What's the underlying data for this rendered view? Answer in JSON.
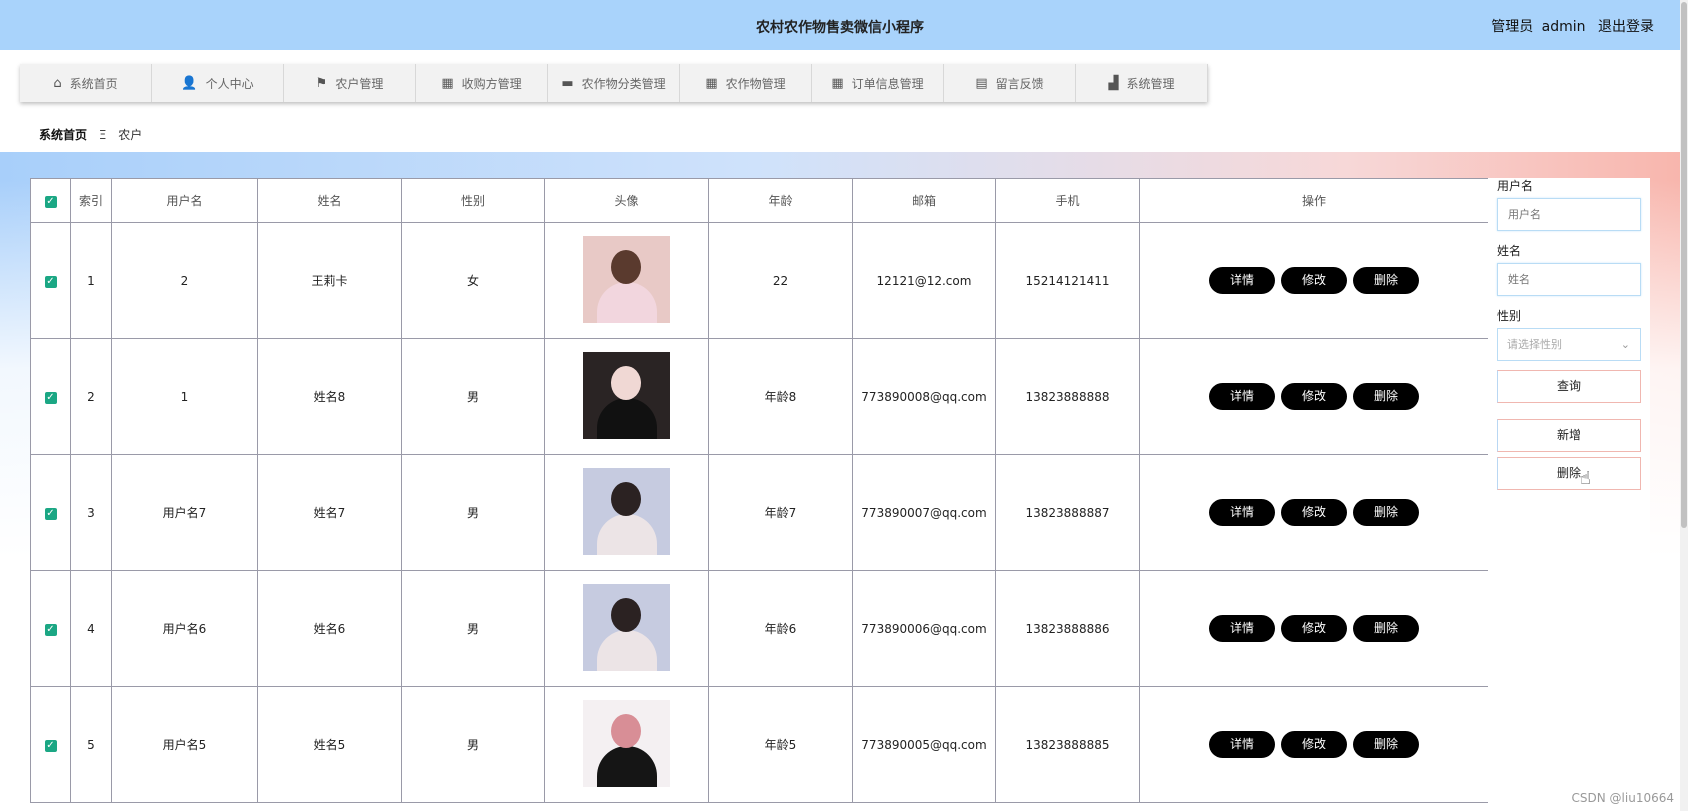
{
  "header": {
    "title": "农村农作物售卖微信小程序",
    "role": "管理员",
    "username": "admin",
    "logout": "退出登录"
  },
  "nav": [
    {
      "label": "系统首页",
      "icon": "home-icon",
      "glyph": "⌂"
    },
    {
      "label": "个人中心",
      "icon": "person-icon",
      "glyph": "👤"
    },
    {
      "label": "农户管理",
      "icon": "flag-icon",
      "glyph": "⚑"
    },
    {
      "label": "收购方管理",
      "icon": "grid-icon",
      "glyph": "▦"
    },
    {
      "label": "农作物分类管理",
      "icon": "briefcase-icon",
      "glyph": "▬"
    },
    {
      "label": "农作物管理",
      "icon": "grid-icon",
      "glyph": "▦"
    },
    {
      "label": "订单信息管理",
      "icon": "grid-icon",
      "glyph": "▦"
    },
    {
      "label": "留言反馈",
      "icon": "clipboard-icon",
      "glyph": "▤"
    },
    {
      "label": "系统管理",
      "icon": "settings-icon",
      "glyph": "▟"
    }
  ],
  "breadcrumb": {
    "home": "系统首页",
    "separator": "Ξ",
    "current": "农户"
  },
  "table": {
    "columns": [
      "索引",
      "用户名",
      "姓名",
      "性别",
      "头像",
      "年龄",
      "邮箱",
      "手机",
      "操作"
    ],
    "rows": [
      {
        "index": "1",
        "username": "2",
        "name": "王莉卡",
        "gender": "女",
        "age": "22",
        "email": "12121@12.com",
        "phone": "15214121411",
        "avatar_colors": [
          "#e8c9c6",
          "#5a3a2e",
          "#f2d6de"
        ]
      },
      {
        "index": "2",
        "username": "1",
        "name": "姓名8",
        "gender": "男",
        "age": "年龄8",
        "email": "773890008@qq.com",
        "phone": "13823888888",
        "avatar_colors": [
          "#2a2424",
          "#f0d8d4",
          "#111111"
        ]
      },
      {
        "index": "3",
        "username": "用户名7",
        "name": "姓名7",
        "gender": "男",
        "age": "年龄7",
        "email": "773890007@qq.com",
        "phone": "13823888887",
        "avatar_colors": [
          "#c6cbe0",
          "#2b2222",
          "#ece4e6"
        ]
      },
      {
        "index": "4",
        "username": "用户名6",
        "name": "姓名6",
        "gender": "男",
        "age": "年龄6",
        "email": "773890006@qq.com",
        "phone": "13823888886",
        "avatar_colors": [
          "#c6cbe0",
          "#2b2222",
          "#ece4e6"
        ]
      },
      {
        "index": "5",
        "username": "用户名5",
        "name": "姓名5",
        "gender": "男",
        "age": "年龄5",
        "email": "773890005@qq.com",
        "phone": "13823888885",
        "avatar_colors": [
          "#f4f0f2",
          "#d88e96",
          "#151515"
        ]
      }
    ],
    "actions": {
      "detail": "详情",
      "edit": "修改",
      "delete": "删除"
    }
  },
  "search": {
    "username_label": "用户名",
    "username_placeholder": "用户名",
    "name_label": "姓名",
    "name_placeholder": "姓名",
    "gender_label": "性别",
    "gender_placeholder": "请选择性别",
    "query": "查询",
    "add": "新增",
    "delete": "删除"
  },
  "watermark": "CSDN @liu10664",
  "colors": {
    "header_bg": "#a9d3fb",
    "checkbox": "#1ba784",
    "action_btn": "#000000"
  }
}
